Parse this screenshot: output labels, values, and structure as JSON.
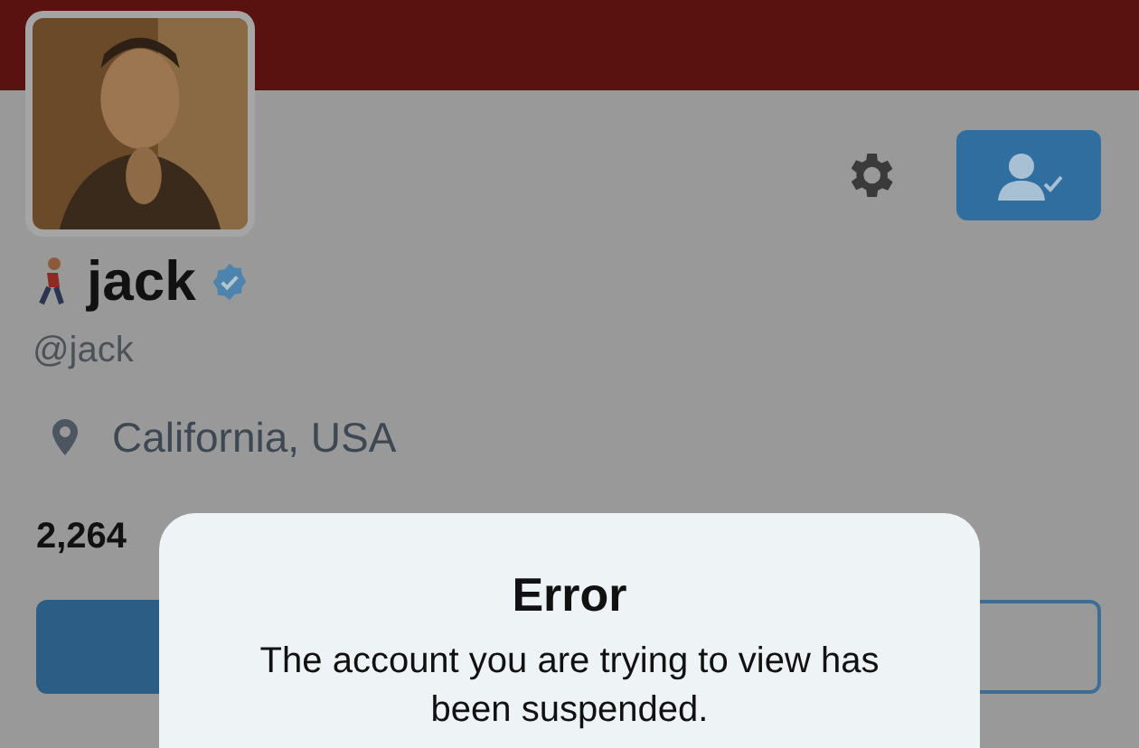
{
  "profile": {
    "name": "jack",
    "verified": true,
    "handle": "@jack",
    "location": "California, USA",
    "following_count": "2,264"
  },
  "dialog": {
    "title": "Error",
    "message": "The account you are trying to view has been suspended."
  }
}
